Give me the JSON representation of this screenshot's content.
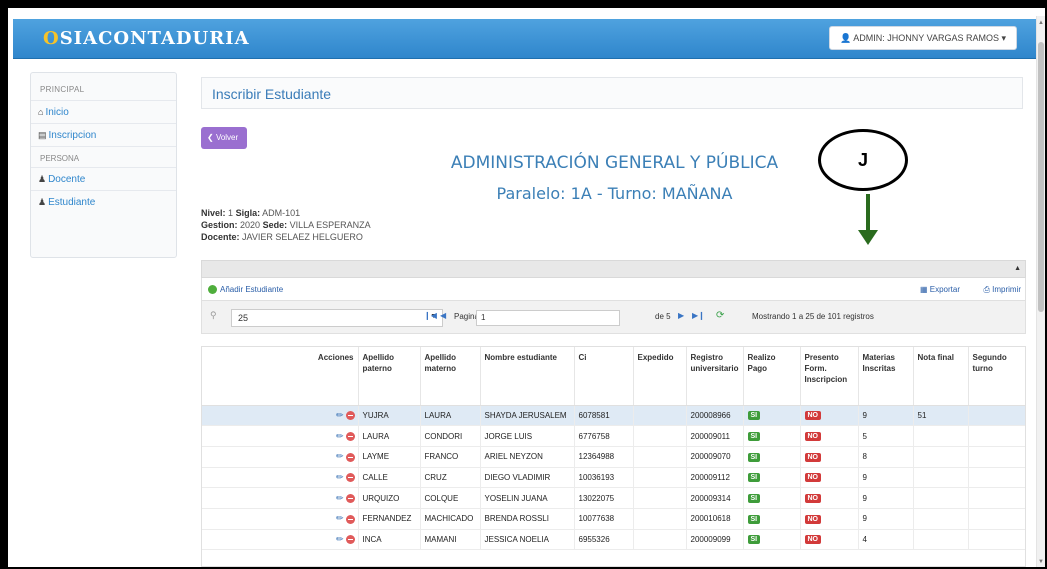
{
  "header": {
    "brand_prefix": "O",
    "brand_text": "SIACONTADURIA",
    "user_label": "ADMIN: JHONNY VARGAS RAMOS",
    "user_caret": "▾"
  },
  "sidebar": {
    "section1": "PRINCIPAL",
    "items1": [
      {
        "label": "Inicio",
        "icon": "home-icon"
      },
      {
        "label": "Inscripcion",
        "icon": "folder-icon"
      }
    ],
    "section2": "PERSONA",
    "items2": [
      {
        "label": "Docente",
        "icon": "user-icon"
      },
      {
        "label": "Estudiante",
        "icon": "user-icon"
      }
    ]
  },
  "page": {
    "panel_title": "Inscribir Estudiante",
    "back_label": "Volver",
    "heading": "ADMINISTRACIÓN GENERAL Y PÚBLICA",
    "subheading": "Paralelo: 1A - Turno: MAÑANA",
    "nivel_label": "Nivel:",
    "nivel_value": "1",
    "sigla_label": "Sigla:",
    "sigla_value": "ADM-101",
    "gestion_label": "Gestion:",
    "gestion_value": "2020",
    "sede_label": "Sede:",
    "sede_value": "VILLA ESPERANZA",
    "docente_label": "Docente:",
    "docente_value": "JAVIER SELAEZ HELGUERO"
  },
  "annotation": {
    "letter": "J"
  },
  "toolbar": {
    "add_label": "Añadir Estudiante",
    "export_label": "Exportar",
    "print_label": "Imprimir"
  },
  "pager": {
    "rows_per_page": "25",
    "page_label": "Pagina",
    "page_value": "1",
    "of_label": "de 5",
    "status": "Mostrando 1 a 25 de 101 registros"
  },
  "table": {
    "columns": [
      "Acciones",
      "Apellido paterno",
      "Apellido materno",
      "Nombre estudiante",
      "Ci",
      "Expedido",
      "Registro universitario",
      "Realizo Pago",
      "Presento Form. Inscripcion",
      "Materias Inscritas",
      "Nota final",
      "Segundo turno"
    ],
    "rows": [
      {
        "paterno": "YUJRA",
        "materno": "LAURA",
        "nombre": "SHAYDA JERUSALEM",
        "ci": "6078581",
        "expedido": "",
        "registro": "200008966",
        "pago": "SI",
        "form": "NO",
        "materias": "9",
        "nota": "51",
        "segundo": ""
      },
      {
        "paterno": "LAURA",
        "materno": "CONDORI",
        "nombre": "JORGE LUIS",
        "ci": "6776758",
        "expedido": "",
        "registro": "200009011",
        "pago": "SI",
        "form": "NO",
        "materias": "5",
        "nota": "",
        "segundo": ""
      },
      {
        "paterno": "LAYME",
        "materno": "FRANCO",
        "nombre": "ARIEL NEYZON",
        "ci": "12364988",
        "expedido": "",
        "registro": "200009070",
        "pago": "SI",
        "form": "NO",
        "materias": "8",
        "nota": "",
        "segundo": ""
      },
      {
        "paterno": "CALLE",
        "materno": "CRUZ",
        "nombre": "DIEGO VLADIMIR",
        "ci": "10036193",
        "expedido": "",
        "registro": "200009112",
        "pago": "SI",
        "form": "NO",
        "materias": "9",
        "nota": "",
        "segundo": ""
      },
      {
        "paterno": "URQUIZO",
        "materno": "COLQUE",
        "nombre": "YOSELIN JUANA",
        "ci": "13022075",
        "expedido": "",
        "registro": "200009314",
        "pago": "SI",
        "form": "NO",
        "materias": "9",
        "nota": "",
        "segundo": ""
      },
      {
        "paterno": "FERNANDEZ",
        "materno": "MACHICADO",
        "nombre": "BRENDA ROSSLI",
        "ci": "10077638",
        "expedido": "",
        "registro": "200010618",
        "pago": "SI",
        "form": "NO",
        "materias": "9",
        "nota": "",
        "segundo": ""
      },
      {
        "paterno": "INCA",
        "materno": "MAMANI",
        "nombre": "JESSICA NOELIA",
        "ci": "6955326",
        "expedido": "",
        "registro": "200009099",
        "pago": "SI",
        "form": "NO",
        "materias": "4",
        "nota": "",
        "segundo": ""
      }
    ]
  },
  "colors": {
    "navbar": "#3a92d6",
    "accent_text": "#3b7fb6",
    "back_button": "#9a6fd0",
    "si_badge": "#3e9c3a",
    "no_badge": "#d23a3a",
    "selected_row": "#dfeaf5",
    "arrow": "#2a6b1e"
  }
}
